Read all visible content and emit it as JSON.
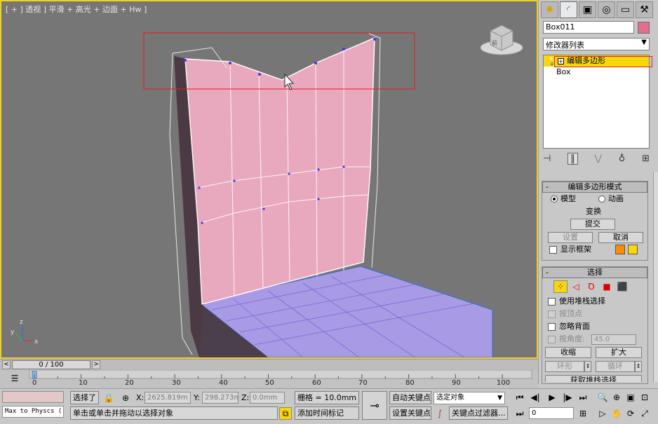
{
  "viewport": {
    "label": "[ + ] 透视 ] 平滑 + 高光 + 边面 + Hw ]",
    "axis_labels": [
      "z",
      "y",
      "x"
    ],
    "viewcube_label": "前"
  },
  "panel": {
    "tabs": [
      "create-icon",
      "modify-icon",
      "hierarchy-icon",
      "motion-icon",
      "display-icon",
      "utilities-icon"
    ],
    "object_name": "Box011",
    "object_color": "#e0708c",
    "modifier_list_label": "修改器列表",
    "stack": [
      {
        "label": "编辑多边形",
        "selected": true
      },
      {
        "label": "Box",
        "selected": false
      }
    ],
    "edit_poly_mode": {
      "title": "编辑多边形模式",
      "model_label": "模型",
      "animate_label": "动画",
      "transform_label": "变换",
      "commit_label": "提交",
      "settings_label": "设置",
      "cancel_label": "取消",
      "show_cage_label": "显示框架",
      "cage_colors": [
        "#ff8c00",
        "#ffd800"
      ]
    },
    "selection": {
      "title": "选择",
      "use_stack_label": "使用堆栈选择",
      "by_vertex_label": "按顶点",
      "ignore_backfacing_label": "忽略背面",
      "by_angle_label": "按角度:",
      "angle_value": "45.0",
      "shrink_label": "收缩",
      "grow_label": "扩大",
      "ring_label": "环形",
      "loop_label": "循环",
      "get_stack_label": "获取堆栈选择"
    }
  },
  "timeline": {
    "frame_display": "0 / 100",
    "ticks": [
      "0",
      "10",
      "20",
      "30",
      "40",
      "50",
      "60",
      "70",
      "80",
      "90",
      "100"
    ]
  },
  "status": {
    "script_listener": "Max to Physcs (",
    "selected_label": "选择了",
    "x_label": "X:",
    "x_value": "2625.819m",
    "y_label": "Y:",
    "y_value": "298.273mm",
    "z_label": "Z:",
    "z_value": "0.0mm",
    "grid_label": "栅格 = 10.0mm",
    "prompt": "单击或单击并拖动以选择对象",
    "add_time_tag": "添加时间标记",
    "auto_key": "自动关键点",
    "set_key": "设置关键点",
    "selected_object": "选定对象",
    "key_filters": "关键点过滤器...",
    "current_frame": "0"
  }
}
